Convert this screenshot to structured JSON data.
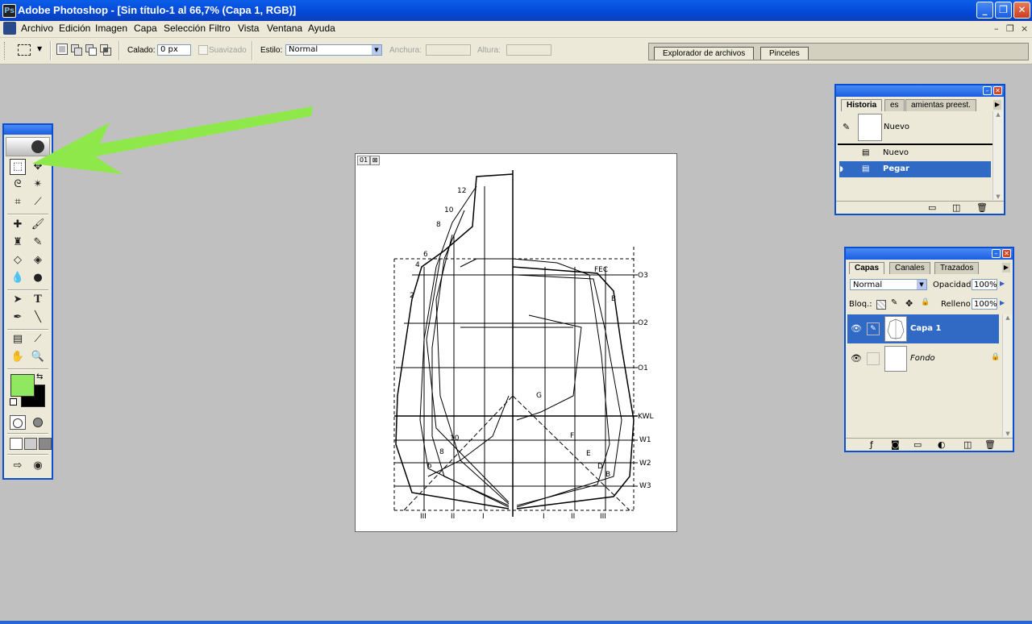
{
  "window": {
    "app_icon": "Ps",
    "title": "Adobe Photoshop - [Sin título-1 al 66,7% (Capa 1, RGB)]",
    "minimize": "_",
    "maximize": "❐",
    "close": "✕"
  },
  "menu": {
    "items": [
      "Archivo",
      "Edición",
      "Imagen",
      "Capa",
      "Selección",
      "Filtro",
      "Vista",
      "Ventana",
      "Ayuda"
    ],
    "mdi_minimize": "–",
    "mdi_restore": "❐",
    "mdi_close": "×"
  },
  "options": {
    "calado_label": "Calado:",
    "calado_value": "0 px",
    "suavizado_label": "Suavizado",
    "estilo_label": "Estilo:",
    "estilo_value": "Normal",
    "anchura_label": "Anchura:",
    "altura_label": "Altura:",
    "well_tabs": [
      "Explorador de archivos",
      "Pinceles"
    ]
  },
  "toolbox": {
    "foreground_color": "#90e860",
    "background_color": "#000000"
  },
  "document": {
    "tab_label": "01",
    "station_labels": [
      "12",
      "10",
      "8",
      "6",
      "4",
      "2"
    ],
    "right_labels": [
      "O3",
      "O2",
      "O1",
      "KWL",
      "W1",
      "W2",
      "W3"
    ],
    "bottom_labels": [
      "III",
      "II",
      "I",
      "I",
      "II",
      "III"
    ],
    "top_right_letters": "FEC",
    "inner_labels": [
      "B",
      "G",
      "10",
      "8",
      "6",
      "F",
      "E",
      "D",
      "B"
    ]
  },
  "history": {
    "tabs": [
      "Historia",
      "es",
      "amientas preest."
    ],
    "snapshot_label": "Nuevo",
    "states": [
      "Nuevo",
      "Pegar"
    ],
    "selected_state": "Pegar"
  },
  "layers": {
    "tabs": [
      "Capas",
      "Canales",
      "Trazados"
    ],
    "blend_mode": "Normal",
    "opacity_label": "Opacidad:",
    "opacity_value": "100%",
    "lock_label": "Bloq.:",
    "fill_label": "Relleno:",
    "fill_value": "100%",
    "items": [
      {
        "name": "Capa 1",
        "selected": true,
        "italic": false
      },
      {
        "name": "Fondo",
        "selected": false,
        "italic": true
      }
    ]
  }
}
